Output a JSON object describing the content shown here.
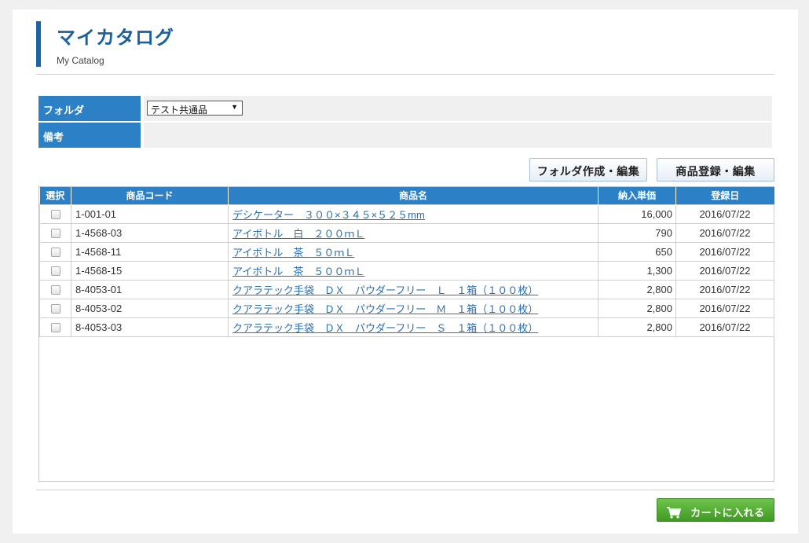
{
  "header": {
    "title": "マイカタログ",
    "subtitle": "My Catalog"
  },
  "form": {
    "folder_label": "フォルダ",
    "folder_selected": "テスト共通品",
    "note_label": "備考",
    "note_value": ""
  },
  "actions": {
    "folder_edit_label": "フォルダ作成・編集",
    "product_edit_label": "商品登録・編集",
    "cart_label": "カートに入れる"
  },
  "table": {
    "headers": {
      "select": "選択",
      "code": "商品コード",
      "name": "商品名",
      "price": "納入単価",
      "date": "登録日"
    },
    "rows": [
      {
        "code": "1-001-01",
        "name": "デシケーター　３００×３４５×５２５mm",
        "price": "16,000",
        "date": "2016/07/22"
      },
      {
        "code": "1-4568-03",
        "name": "アイボトル　白　２００ｍＬ",
        "price": "790",
        "date": "2016/07/22"
      },
      {
        "code": "1-4568-11",
        "name": "アイボトル　茶　５０ｍＬ",
        "price": "650",
        "date": "2016/07/22"
      },
      {
        "code": "1-4568-15",
        "name": "アイボトル　茶　５００ｍＬ",
        "price": "1,300",
        "date": "2016/07/22"
      },
      {
        "code": "8-4053-01",
        "name": "クアラテック手袋　ＤＸ　パウダーフリー　Ｌ　１箱（１００枚）",
        "price": "2,800",
        "date": "2016/07/22"
      },
      {
        "code": "8-4053-02",
        "name": "クアラテック手袋　ＤＸ　パウダーフリー　Ｍ　１箱（１００枚）",
        "price": "2,800",
        "date": "2016/07/22"
      },
      {
        "code": "8-4053-03",
        "name": "クアラテック手袋　ＤＸ　パウダーフリー　Ｓ　１箱（１００枚）",
        "price": "2,800",
        "date": "2016/07/22"
      }
    ]
  },
  "colors": {
    "accent": "#2c80c6",
    "title": "#1a5f9f",
    "cart": "#4aa82e"
  }
}
